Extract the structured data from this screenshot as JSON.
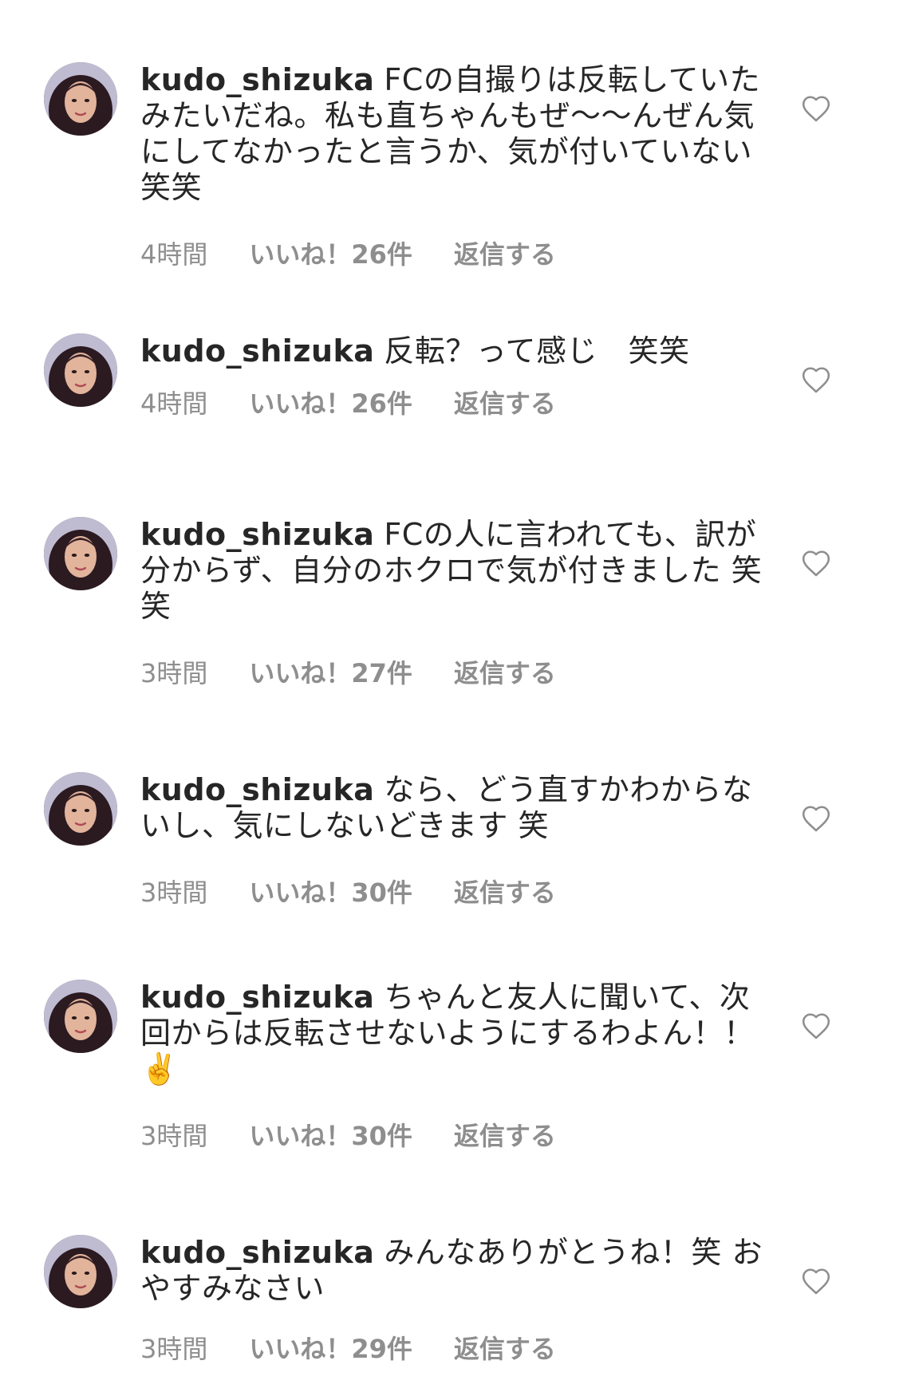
{
  "comments": [
    {
      "username": "kudo_shizuka",
      "text": "FCの自撮りは反転していたみたいだね。私も直ちゃんもぜ〜〜んぜん気にしてなかったと言うか、気が付いていない笑笑",
      "time": "4時間",
      "likes": "いいね！26件",
      "reply": "返信する"
    },
    {
      "username": "kudo_shizuka",
      "text": "反転？って感じ　笑笑",
      "time": "4時間",
      "likes": "いいね！26件",
      "reply": "返信する"
    },
    {
      "username": "kudo_shizuka",
      "text": "FCの人に言われても、訳が分からず、自分のホクロで気が付きました 笑笑",
      "time": "3時間",
      "likes": "いいね！27件",
      "reply": "返信する"
    },
    {
      "username": "kudo_shizuka",
      "text": "なら、どう直すかわからないし、気にしないどきます 笑",
      "time": "3時間",
      "likes": "いいね！30件",
      "reply": "返信する"
    },
    {
      "username": "kudo_shizuka",
      "text": "ちゃんと友人に聞いて、次回からは反転させないようにするわよん！！✌️",
      "time": "3時間",
      "likes": "いいね！30件",
      "reply": "返信する"
    },
    {
      "username": "kudo_shizuka",
      "text": "みんなありがとうね！笑 おやすみなさい",
      "time": "3時間",
      "likes": "いいね！29件",
      "reply": "返信する"
    }
  ],
  "icons": {
    "like": "heart-outline-icon",
    "avatar": "profile-photo"
  },
  "colors": {
    "text": "#262626",
    "meta": "#8e8e8e",
    "background": "#ffffff"
  }
}
